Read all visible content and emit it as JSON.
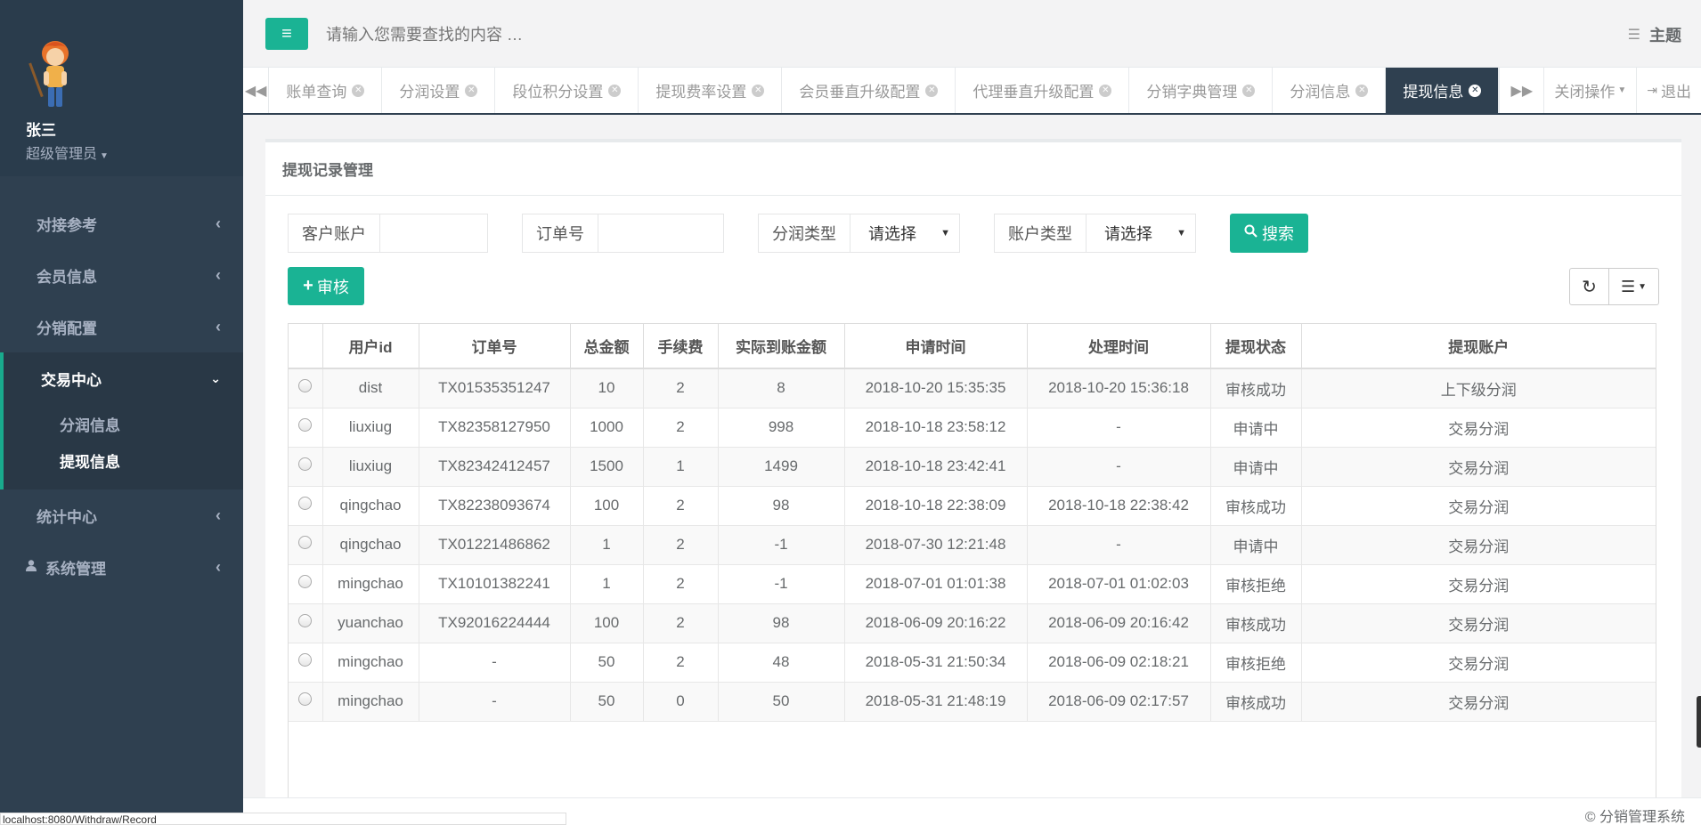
{
  "user": {
    "name": "张三",
    "role": "超级管理员"
  },
  "sidebar": {
    "items": [
      {
        "label": "对接参考"
      },
      {
        "label": "会员信息"
      },
      {
        "label": "分销配置"
      },
      {
        "label": "交易中心"
      },
      {
        "label": "统计中心"
      },
      {
        "label": "系统管理"
      }
    ],
    "sub_items": [
      {
        "label": "分润信息"
      },
      {
        "label": "提现信息"
      }
    ]
  },
  "topbar": {
    "search_placeholder": "请输入您需要查找的内容 …",
    "theme_label": "主题"
  },
  "tabs": [
    {
      "label": "账单查询"
    },
    {
      "label": "分润设置"
    },
    {
      "label": "段位积分设置"
    },
    {
      "label": "提现费率设置"
    },
    {
      "label": "会员垂直升级配置"
    },
    {
      "label": "代理垂直升级配置"
    },
    {
      "label": "分销字典管理"
    },
    {
      "label": "分润信息"
    },
    {
      "label": "提现信息"
    }
  ],
  "tab_actions": {
    "close_ops": "关闭操作",
    "logout": "退出"
  },
  "panel": {
    "title": "提现记录管理"
  },
  "filters": {
    "customer_account_label": "客户账户",
    "order_no_label": "订单号",
    "profit_type_label": "分润类型",
    "profit_type_value": "请选择",
    "account_type_label": "账户类型",
    "account_type_value": "请选择",
    "search_label": "搜索"
  },
  "toolbar": {
    "audit_label": "审核"
  },
  "table": {
    "columns": [
      "用户id",
      "订单号",
      "总金额",
      "手续费",
      "实际到账金额",
      "申请时间",
      "处理时间",
      "提现状态",
      "提现账户"
    ],
    "rows": [
      [
        "dist",
        "TX01535351247",
        "10",
        "2",
        "8",
        "2018-10-20 15:35:35",
        "2018-10-20 15:36:18",
        "审核成功",
        "上下级分润"
      ],
      [
        "liuxiug",
        "TX82358127950",
        "1000",
        "2",
        "998",
        "2018-10-18 23:58:12",
        "-",
        "申请中",
        "交易分润"
      ],
      [
        "liuxiug",
        "TX82342412457",
        "1500",
        "1",
        "1499",
        "2018-10-18 23:42:41",
        "-",
        "申请中",
        "交易分润"
      ],
      [
        "qingchao",
        "TX82238093674",
        "100",
        "2",
        "98",
        "2018-10-18 22:38:09",
        "2018-10-18 22:38:42",
        "审核成功",
        "交易分润"
      ],
      [
        "qingchao",
        "TX01221486862",
        "1",
        "2",
        "-1",
        "2018-07-30 12:21:48",
        "-",
        "申请中",
        "交易分润"
      ],
      [
        "mingchao",
        "TX10101382241",
        "1",
        "2",
        "-1",
        "2018-07-01 01:01:38",
        "2018-07-01 01:02:03",
        "审核拒绝",
        "交易分润"
      ],
      [
        "yuanchao",
        "TX92016224444",
        "100",
        "2",
        "98",
        "2018-06-09 20:16:22",
        "2018-06-09 20:16:42",
        "审核成功",
        "交易分润"
      ],
      [
        "mingchao",
        "-",
        "50",
        "2",
        "48",
        "2018-05-31 21:50:34",
        "2018-06-09 02:18:21",
        "审核拒绝",
        "交易分润"
      ],
      [
        "mingchao",
        "-",
        "50",
        "0",
        "50",
        "2018-05-31 21:48:19",
        "2018-06-09 02:17:57",
        "审核成功",
        "交易分润"
      ]
    ]
  },
  "footer": {
    "copyright": "© 分销管理系统"
  },
  "status_url": "localhost:8080/Withdraw/Record",
  "colors": {
    "sidebar": "#2f4050",
    "accent": "#1ab394",
    "active_tab": "#2f4050"
  }
}
